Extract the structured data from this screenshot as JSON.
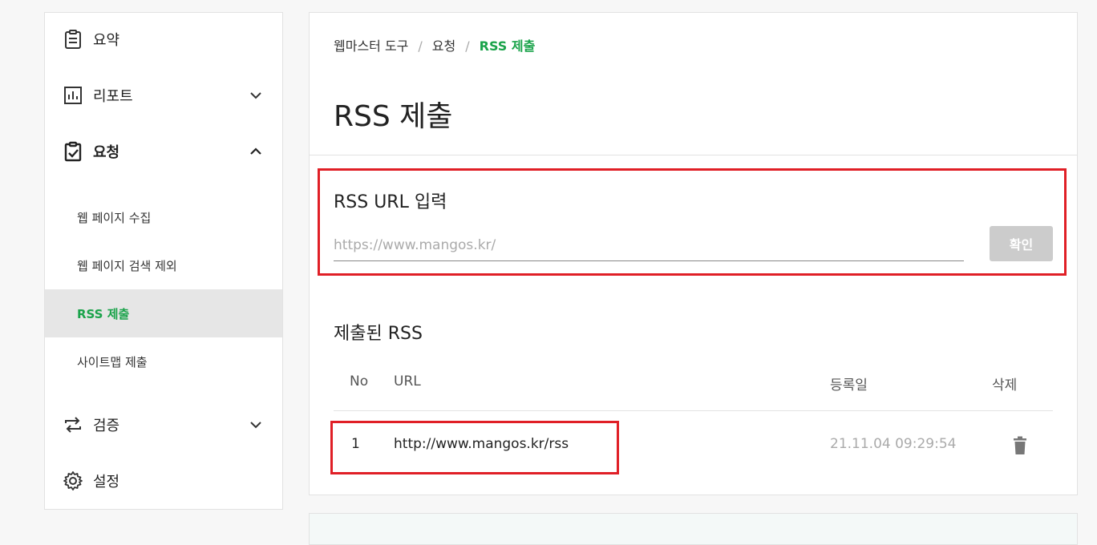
{
  "sidebar": {
    "items": [
      {
        "label": "요약",
        "icon": "clipboard-icon"
      },
      {
        "label": "리포트",
        "icon": "bar-chart-icon",
        "chevron": "chevron-down-icon"
      },
      {
        "label": "요청",
        "icon": "clipboard-check-icon",
        "chevron": "chevron-up-icon",
        "expanded": true
      },
      {
        "label": "검증",
        "icon": "repeat-icon",
        "chevron": "chevron-down-icon"
      },
      {
        "label": "설정",
        "icon": "gear-icon"
      }
    ],
    "sub_items": [
      {
        "label": "웹 페이지 수집"
      },
      {
        "label": "웹 페이지 검색 제외"
      },
      {
        "label": "RSS 제출",
        "active": true
      },
      {
        "label": "사이트맵 제출"
      }
    ]
  },
  "breadcrumb": {
    "items": [
      "웹마스터 도구",
      "요청",
      "RSS 제출"
    ],
    "separator": "/"
  },
  "page_title": "RSS 제출",
  "rss_input": {
    "title": "RSS URL 입력",
    "placeholder": "https://www.mangos.kr/",
    "value": "",
    "button_label": "확인"
  },
  "submitted": {
    "title": "제출된 RSS",
    "columns": [
      "No",
      "URL",
      "등록일",
      "삭제"
    ],
    "rows": [
      {
        "no": "1",
        "url": "http://www.mangos.kr/rss",
        "date": "21.11.04 09:29:54",
        "delete_icon": "trash-icon"
      }
    ]
  },
  "colors": {
    "accent": "#1aa34a",
    "highlight": "#e01f26",
    "button_disabled": "#cccccc"
  }
}
